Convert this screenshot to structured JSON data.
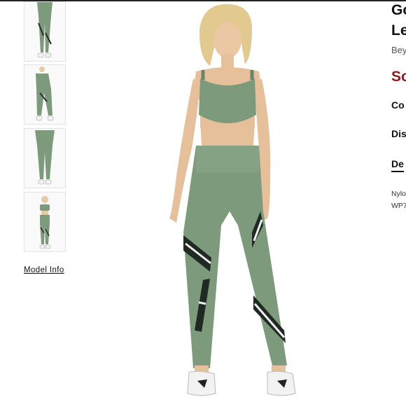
{
  "colors": {
    "legging_green": "#7d9a7c",
    "sale_red": "#8b1a1a",
    "shoe": "#f2f2f2"
  },
  "thumbnails": [
    {
      "view": "legs-front"
    },
    {
      "view": "legs-side"
    },
    {
      "view": "legs-back"
    },
    {
      "view": "full-outfit"
    }
  ],
  "model_info_link": "Model Info",
  "product": {
    "title_line1": "Go",
    "title_line2": "Le",
    "brand": "Bey",
    "sale_price": "So",
    "color_label": "Co",
    "discount_label": "Dis",
    "details_tab": "De",
    "desc_line1": "Nylo",
    "desc_line2": "WP7"
  }
}
